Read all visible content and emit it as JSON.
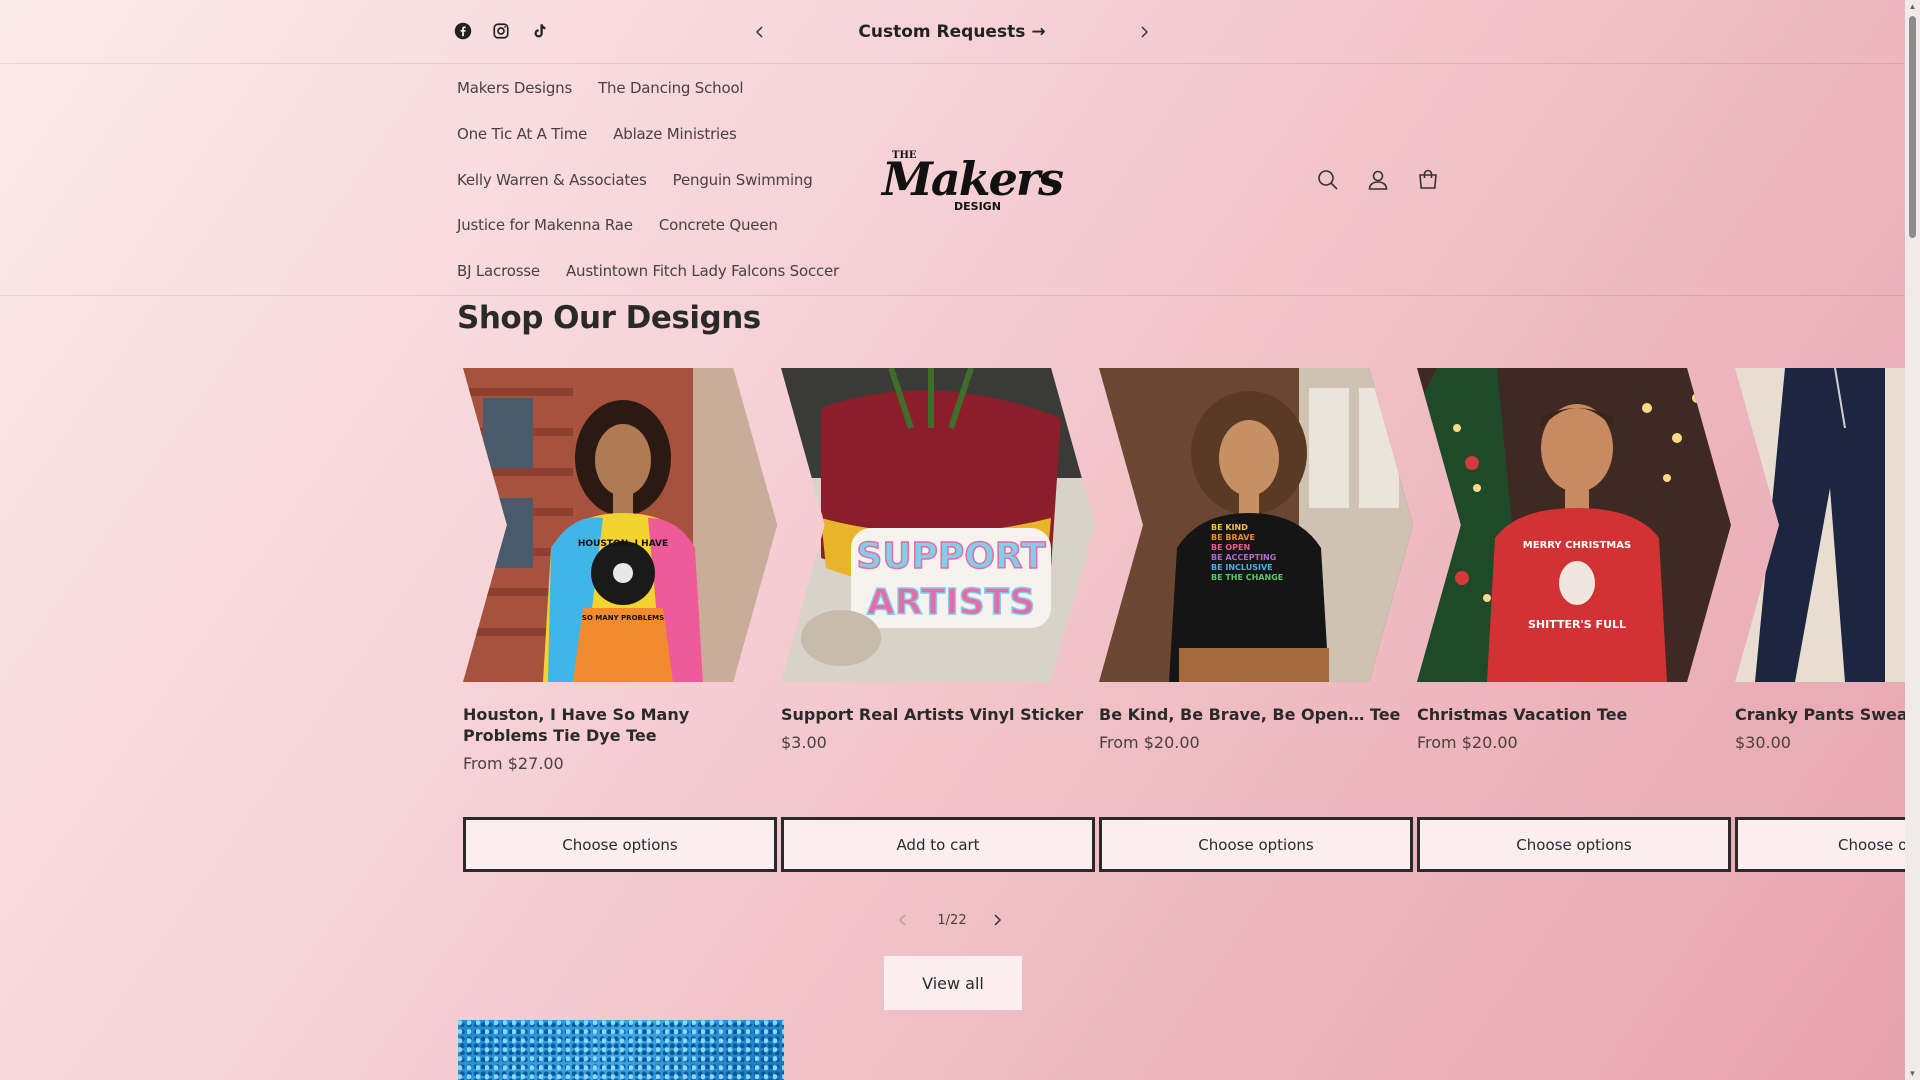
{
  "announcement": {
    "text": "Custom Requests",
    "arrow": "→"
  },
  "social_icons": [
    "facebook-icon",
    "instagram-icon",
    "tiktok-icon"
  ],
  "nav": {
    "rows": [
      [
        "Makers Designs",
        "The Dancing School"
      ],
      [
        "One Tic At A Time",
        "Ablaze Ministries"
      ],
      [
        "Kelly Warren & Associates",
        "Penguin Swimming"
      ],
      [
        "Justice for Makenna Rae",
        "Concrete Queen"
      ],
      [
        "BJ Lacrosse",
        "Austintown Fitch Lady Falcons Soccer"
      ]
    ]
  },
  "logo": {
    "the": "THE",
    "makers": "Makers",
    "design": "DESIGN"
  },
  "header_icons": [
    "search-icon",
    "account-icon",
    "cart-icon"
  ],
  "section": {
    "title": "Shop Our Designs"
  },
  "products": [
    {
      "title": "Houston, I Have So Many Problems Tie Dye Tee",
      "price": "From $27.00",
      "button": "Choose options",
      "art_title": "HOUSTON, I HAVE",
      "art_sub": "SO MANY PROBLEMS"
    },
    {
      "title": "Support Real Artists Vinyl Sticker",
      "price": "$3.00",
      "button": "Add to cart",
      "art_title": "SUPPORT",
      "art_sub": "ARTISTS"
    },
    {
      "title": "Be Kind, Be Brave, Be Open… Tee",
      "price": "From $20.00",
      "button": "Choose options",
      "art_lines": [
        "BE KIND",
        "BE BRAVE",
        "BE OPEN",
        "BE ACCEPTING",
        "BE INCLUSIVE",
        "BE THE CHANGE"
      ]
    },
    {
      "title": "Christmas Vacation Tee",
      "price": "From $20.00",
      "button": "Choose options",
      "art_title": "MERRY CHRISTMAS",
      "art_sub": "SHITTER'S FULL"
    },
    {
      "title": "Cranky Pants Sweat",
      "price": "$30.00",
      "button": "Choose op"
    }
  ],
  "pager": {
    "count": "1/22"
  },
  "view_all": "View all",
  "colors": {
    "accent_dark": "#2a2a2a",
    "button_bg": "#fbeef0"
  }
}
